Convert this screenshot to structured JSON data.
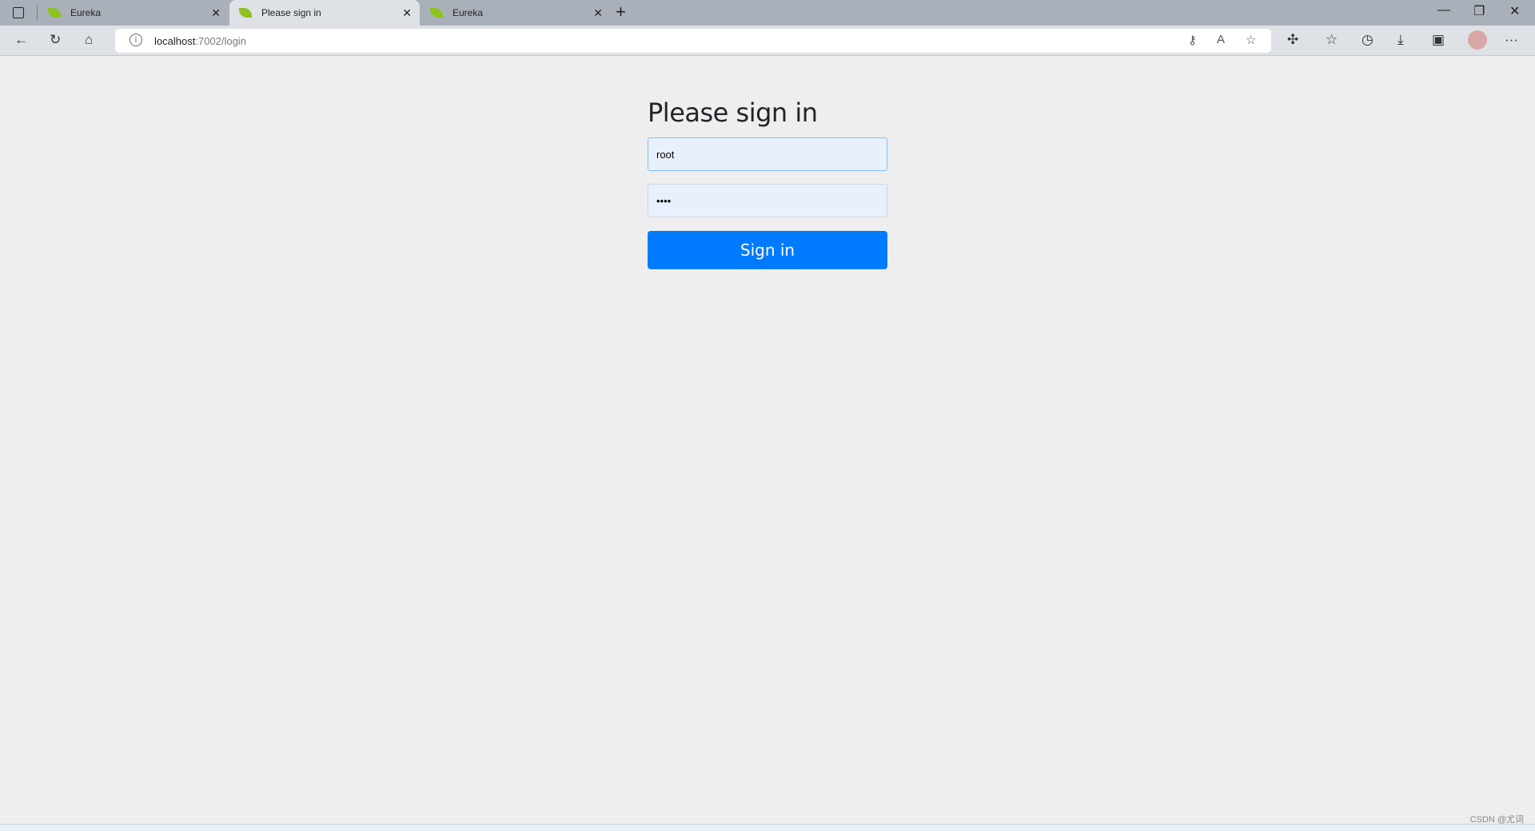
{
  "browser": {
    "tabs": [
      {
        "label": "Eureka",
        "active": false
      },
      {
        "label": "Please sign in",
        "active": true
      },
      {
        "label": "Eureka",
        "active": false
      }
    ],
    "url_host": "localhost",
    "url_rest": ":7002/login",
    "icons": [
      "back-icon",
      "refresh-icon",
      "home-icon",
      "key-icon",
      "read-aloud-icon",
      "add-favorite-icon",
      "extensions-icon",
      "favorites-icon",
      "history-icon",
      "download-icon",
      "collections-icon",
      "avatar",
      "more-icon"
    ]
  },
  "login": {
    "title": "Please sign in",
    "username": "root",
    "password": "••••",
    "submit_label": "Sign in",
    "accent": "#007bff"
  },
  "watermark": "CSDN @尤词"
}
